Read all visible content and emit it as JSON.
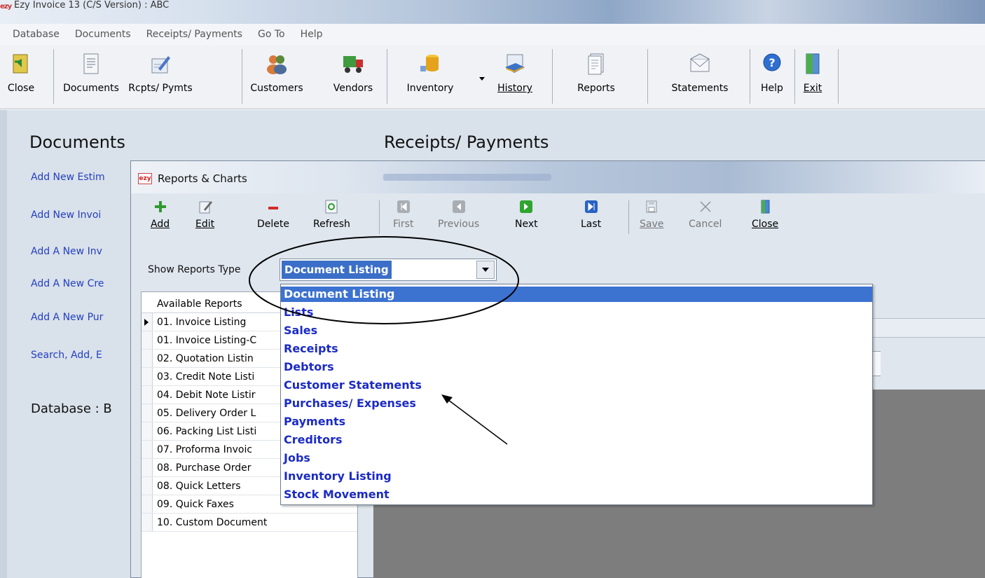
{
  "window": {
    "app_icon": "ezy",
    "title": "Ezy Invoice 13 (C/S Version) : ABC"
  },
  "menu": [
    "Database",
    "Documents",
    "Receipts/ Payments",
    "Go To",
    "Help"
  ],
  "toolbar": {
    "close": "Close",
    "documents": "Documents",
    "rcpts": "Rcpts/ Pymts",
    "customers": "Customers",
    "vendors": "Vendors",
    "inventory": "Inventory",
    "history": "History",
    "reports": "Reports",
    "statements": "Statements",
    "help": "Help",
    "exit": "Exit"
  },
  "workspace": {
    "documents_heading": "Documents",
    "receipts_heading": "Receipts/ Payments",
    "links": [
      "Add New Estim",
      "Add New Invoi",
      "Add A New Inv",
      "Add A New Cre",
      "Add A New Pur",
      "Search, Add, E"
    ],
    "database_label": "Database : B"
  },
  "dialog": {
    "icon": "ezy",
    "title": "Reports & Charts",
    "toolbar": {
      "add": "Add",
      "edit": "Edit",
      "delete": "Delete",
      "refresh": "Refresh",
      "first": "First",
      "previous": "Previous",
      "next": "Next",
      "last": "Last",
      "save": "Save",
      "cancel": "Cancel",
      "close": "Close"
    },
    "show_reports_type_label": "Show Reports Type",
    "selected_type": "Document Listing",
    "grid_header": "Available Reports",
    "reports": [
      "01. Invoice Listing",
      "01. Invoice Listing-C",
      "02. Quotation Listin",
      "03. Credit Note Listi",
      "04. Debit Note Listir",
      "05. Delivery Order L",
      "06. Packing List Listi",
      "07. Proforma Invoic",
      "08. Purchase Order",
      "08. Quick Letters",
      "09. Quick Faxes",
      "10. Custom Document"
    ],
    "dropdown_options": [
      "Document Listing",
      "Lists",
      "Sales",
      "Receipts",
      "Debtors",
      "Customer Statements",
      "Purchases/ Expenses",
      "Payments",
      "Creditors",
      "Jobs",
      "Inventory Listing",
      "Stock Movement"
    ]
  },
  "colors": {
    "link": "#2440c0",
    "dropdown_text": "#1b2bc4",
    "selection": "#3c72d0"
  }
}
